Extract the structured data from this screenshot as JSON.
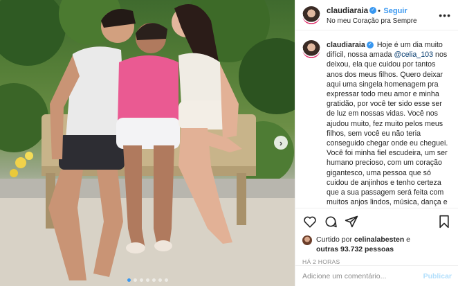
{
  "post": {
    "username": "claudiaraia",
    "separator": "•",
    "follow_label": "Seguir",
    "location": "No meu Coração pra Sempre",
    "more_icon": "more-horizontal-icon",
    "caption_prefix": "Hoje é um dia muito difícil, nossa amada ",
    "caption_mention": "@celia_103",
    "caption_rest": " nos deixou, ela que cuidou por tantos anos dos meus filhos. Quero deixar aqui uma singela homenagem pra expressar todo meu amor e minha gratidão, por você ter sido esse ser de luz em nossas vidas. Você nos ajudou muito, fez muito pelos meus filhos, sem você eu não teria conseguido chegar onde eu cheguei. Você foi minha fiel escudeira, um ser humano precioso, com um coração gigantesco, uma pessoa que só cuidou de anjinhos e tenho certeza que a sua passagem será feita com muitos anjos lindos, música, dança e muita alegria! Regina Célia da Silva, nossa Bazinha... vá em paz meu amor, te amamos",
    "liked_by_prefix": "Curtido por ",
    "liked_by_user": "celinalabesten",
    "liked_by_and": " e",
    "others_count": "outras 93.732 pessoas",
    "timestamp": "HÁ 2 HORAS",
    "comment_placeholder": "Adicione um comentário...",
    "publish_label": "Publicar"
  },
  "photo": {
    "nav_arrow": "›",
    "carousel_dots": 7,
    "active_dot": 0
  },
  "colors": {
    "accent": "#3897f0",
    "publish_disabled": "#b2dffc",
    "muted": "#8e8e8e"
  }
}
